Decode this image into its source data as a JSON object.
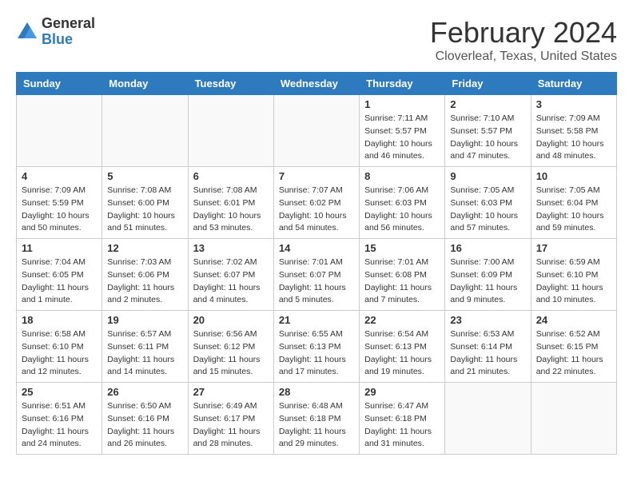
{
  "header": {
    "logo_general": "General",
    "logo_blue": "Blue",
    "month_title": "February 2024",
    "location": "Cloverleaf, Texas, United States"
  },
  "days_of_week": [
    "Sunday",
    "Monday",
    "Tuesday",
    "Wednesday",
    "Thursday",
    "Friday",
    "Saturday"
  ],
  "weeks": [
    [
      {
        "day": "",
        "info": ""
      },
      {
        "day": "",
        "info": ""
      },
      {
        "day": "",
        "info": ""
      },
      {
        "day": "",
        "info": ""
      },
      {
        "day": "1",
        "info": "Sunrise: 7:11 AM\nSunset: 5:57 PM\nDaylight: 10 hours\nand 46 minutes."
      },
      {
        "day": "2",
        "info": "Sunrise: 7:10 AM\nSunset: 5:57 PM\nDaylight: 10 hours\nand 47 minutes."
      },
      {
        "day": "3",
        "info": "Sunrise: 7:09 AM\nSunset: 5:58 PM\nDaylight: 10 hours\nand 48 minutes."
      }
    ],
    [
      {
        "day": "4",
        "info": "Sunrise: 7:09 AM\nSunset: 5:59 PM\nDaylight: 10 hours\nand 50 minutes."
      },
      {
        "day": "5",
        "info": "Sunrise: 7:08 AM\nSunset: 6:00 PM\nDaylight: 10 hours\nand 51 minutes."
      },
      {
        "day": "6",
        "info": "Sunrise: 7:08 AM\nSunset: 6:01 PM\nDaylight: 10 hours\nand 53 minutes."
      },
      {
        "day": "7",
        "info": "Sunrise: 7:07 AM\nSunset: 6:02 PM\nDaylight: 10 hours\nand 54 minutes."
      },
      {
        "day": "8",
        "info": "Sunrise: 7:06 AM\nSunset: 6:03 PM\nDaylight: 10 hours\nand 56 minutes."
      },
      {
        "day": "9",
        "info": "Sunrise: 7:05 AM\nSunset: 6:03 PM\nDaylight: 10 hours\nand 57 minutes."
      },
      {
        "day": "10",
        "info": "Sunrise: 7:05 AM\nSunset: 6:04 PM\nDaylight: 10 hours\nand 59 minutes."
      }
    ],
    [
      {
        "day": "11",
        "info": "Sunrise: 7:04 AM\nSunset: 6:05 PM\nDaylight: 11 hours\nand 1 minute."
      },
      {
        "day": "12",
        "info": "Sunrise: 7:03 AM\nSunset: 6:06 PM\nDaylight: 11 hours\nand 2 minutes."
      },
      {
        "day": "13",
        "info": "Sunrise: 7:02 AM\nSunset: 6:07 PM\nDaylight: 11 hours\nand 4 minutes."
      },
      {
        "day": "14",
        "info": "Sunrise: 7:01 AM\nSunset: 6:07 PM\nDaylight: 11 hours\nand 5 minutes."
      },
      {
        "day": "15",
        "info": "Sunrise: 7:01 AM\nSunset: 6:08 PM\nDaylight: 11 hours\nand 7 minutes."
      },
      {
        "day": "16",
        "info": "Sunrise: 7:00 AM\nSunset: 6:09 PM\nDaylight: 11 hours\nand 9 minutes."
      },
      {
        "day": "17",
        "info": "Sunrise: 6:59 AM\nSunset: 6:10 PM\nDaylight: 11 hours\nand 10 minutes."
      }
    ],
    [
      {
        "day": "18",
        "info": "Sunrise: 6:58 AM\nSunset: 6:10 PM\nDaylight: 11 hours\nand 12 minutes."
      },
      {
        "day": "19",
        "info": "Sunrise: 6:57 AM\nSunset: 6:11 PM\nDaylight: 11 hours\nand 14 minutes."
      },
      {
        "day": "20",
        "info": "Sunrise: 6:56 AM\nSunset: 6:12 PM\nDaylight: 11 hours\nand 15 minutes."
      },
      {
        "day": "21",
        "info": "Sunrise: 6:55 AM\nSunset: 6:13 PM\nDaylight: 11 hours\nand 17 minutes."
      },
      {
        "day": "22",
        "info": "Sunrise: 6:54 AM\nSunset: 6:13 PM\nDaylight: 11 hours\nand 19 minutes."
      },
      {
        "day": "23",
        "info": "Sunrise: 6:53 AM\nSunset: 6:14 PM\nDaylight: 11 hours\nand 21 minutes."
      },
      {
        "day": "24",
        "info": "Sunrise: 6:52 AM\nSunset: 6:15 PM\nDaylight: 11 hours\nand 22 minutes."
      }
    ],
    [
      {
        "day": "25",
        "info": "Sunrise: 6:51 AM\nSunset: 6:16 PM\nDaylight: 11 hours\nand 24 minutes."
      },
      {
        "day": "26",
        "info": "Sunrise: 6:50 AM\nSunset: 6:16 PM\nDaylight: 11 hours\nand 26 minutes."
      },
      {
        "day": "27",
        "info": "Sunrise: 6:49 AM\nSunset: 6:17 PM\nDaylight: 11 hours\nand 28 minutes."
      },
      {
        "day": "28",
        "info": "Sunrise: 6:48 AM\nSunset: 6:18 PM\nDaylight: 11 hours\nand 29 minutes."
      },
      {
        "day": "29",
        "info": "Sunrise: 6:47 AM\nSunset: 6:18 PM\nDaylight: 11 hours\nand 31 minutes."
      },
      {
        "day": "",
        "info": ""
      },
      {
        "day": "",
        "info": ""
      }
    ]
  ]
}
